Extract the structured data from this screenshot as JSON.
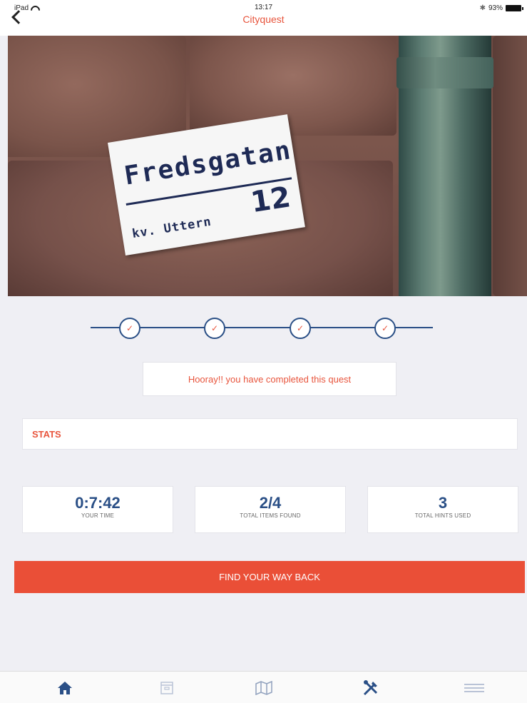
{
  "status_bar": {
    "device": "iPad",
    "time": "13:17",
    "battery": "93%"
  },
  "nav": {
    "title": "Cityquest"
  },
  "hero": {
    "sign_street": "Fredsgatan",
    "sign_number": "12",
    "sign_block": "kv. Uttern"
  },
  "progress": {
    "steps": [
      {
        "status": "completed",
        "mark": "✓"
      },
      {
        "status": "completed",
        "mark": "✓"
      },
      {
        "status": "completed",
        "mark": "✓"
      },
      {
        "status": "completed",
        "mark": "✓"
      }
    ]
  },
  "message": "Hooray!! you have completed this quest",
  "stats": {
    "heading": "STATS",
    "items": [
      {
        "value": "0:7:42",
        "label": "YOUR TIME"
      },
      {
        "value": "2/4",
        "label": "TOTAL ITEMS FOUND"
      },
      {
        "value": "3",
        "label": "TOTAL HINTS USED"
      }
    ]
  },
  "cta": {
    "label": "FIND YOUR WAY BACK"
  },
  "tabbar": {
    "tabs": [
      {
        "icon": "home-icon",
        "active": true
      },
      {
        "icon": "archive-icon",
        "active": false
      },
      {
        "icon": "map-icon",
        "active": false
      },
      {
        "icon": "tools-icon",
        "active": false
      },
      {
        "icon": "menu-icon",
        "active": false
      }
    ]
  },
  "colors": {
    "accent": "#e8553d",
    "primary_blue": "#2a4f86",
    "background": "#efeff4"
  }
}
